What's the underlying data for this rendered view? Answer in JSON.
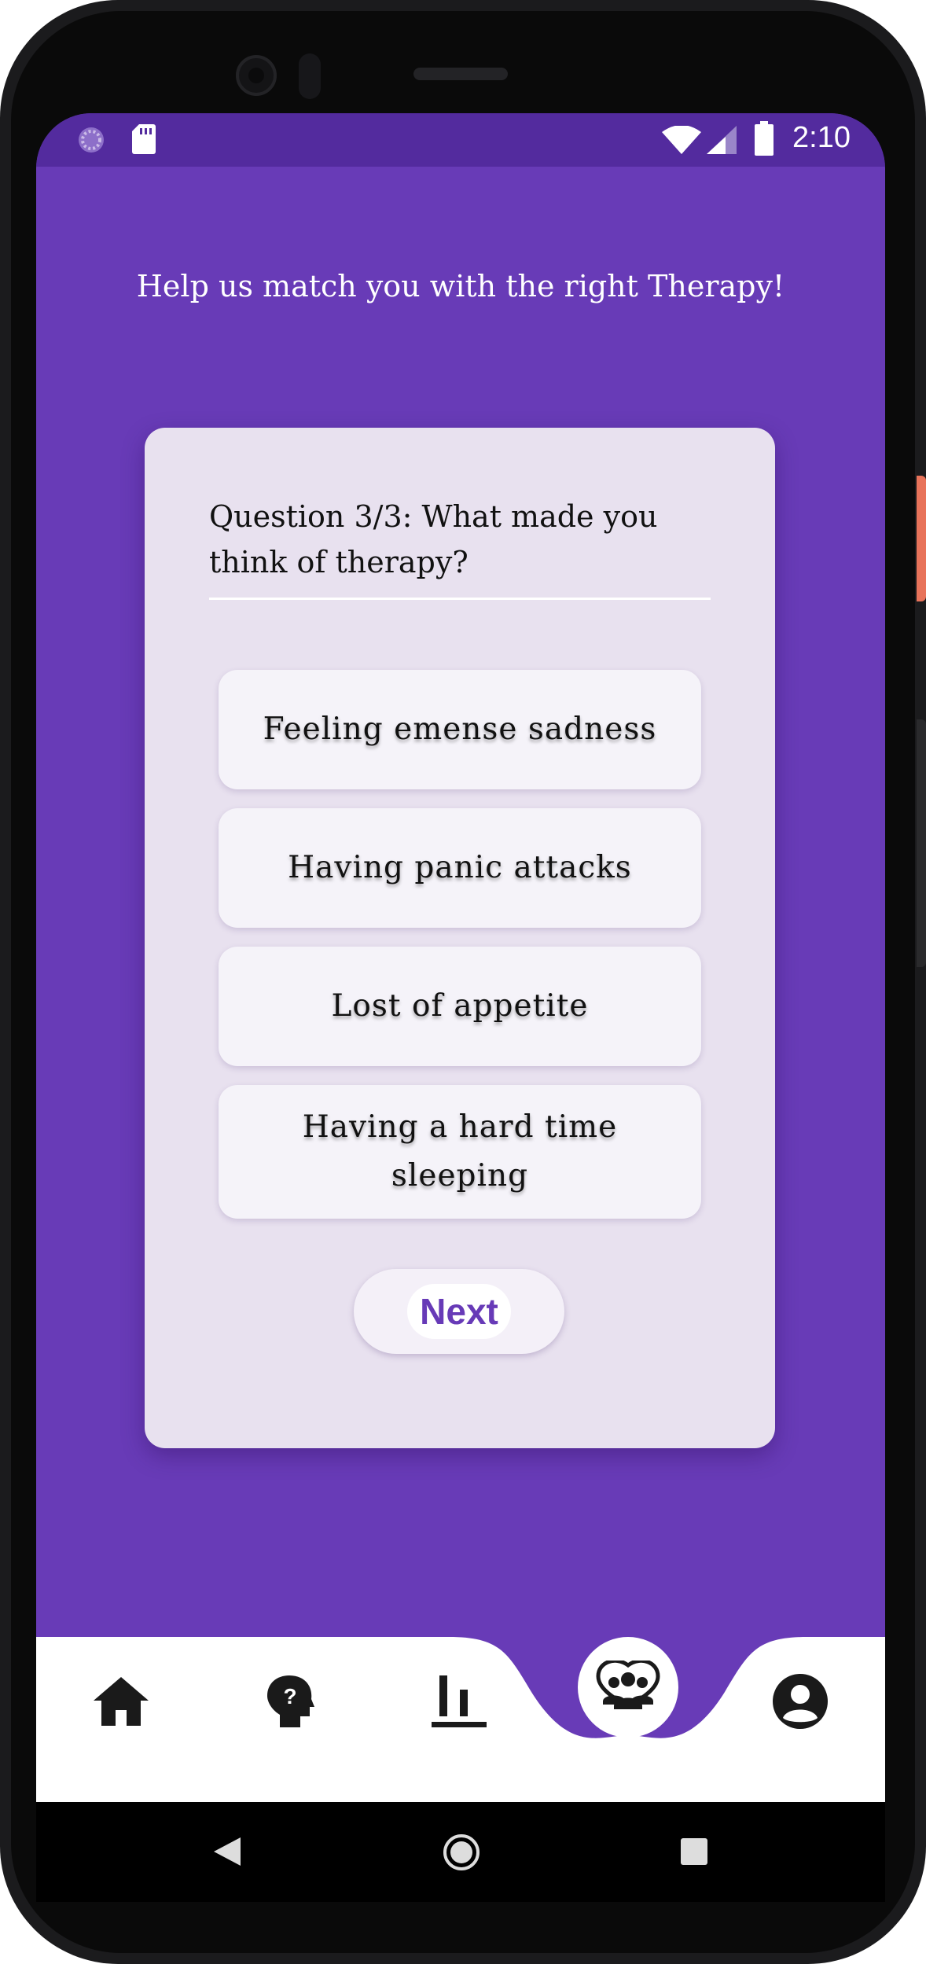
{
  "status_bar": {
    "time": "2:10",
    "icons": [
      "loading-circle-icon",
      "sd-card-icon",
      "wifi-icon",
      "cell-signal-icon",
      "battery-icon"
    ]
  },
  "headline": "Help us match you with the right Therapy!",
  "quiz": {
    "question": "Question 3/3: What made you think of therapy?",
    "options": [
      "Feeling emense sadness",
      "Having panic attacks",
      "Lost of appetite",
      "Having a hard time sleeping"
    ],
    "next_label": "Next"
  },
  "bottom_nav": {
    "items": [
      "home-icon",
      "mental-health-question-icon",
      "stats-bar-icon",
      "group-therapy-icon",
      "account-icon"
    ],
    "selected": "group-therapy-icon"
  },
  "system_nav": [
    "back-icon",
    "home-circle-icon",
    "recents-icon"
  ],
  "colors": {
    "accent": "#673ab7",
    "status_bar": "#532b9e",
    "card": "#e8e1ef",
    "option": "#f5f3f9"
  }
}
